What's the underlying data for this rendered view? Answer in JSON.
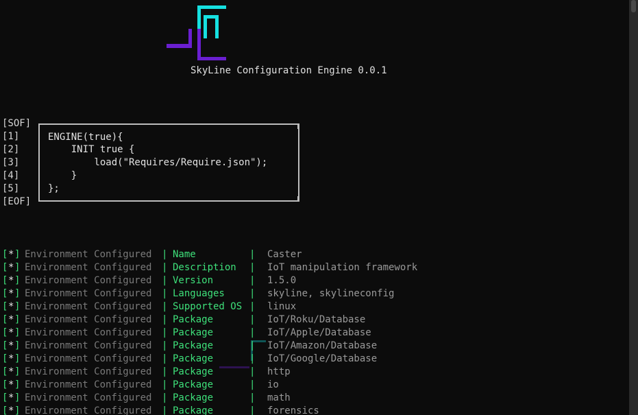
{
  "header": {
    "title": "SkyLine Configuration Engine 0.0.1",
    "colors": {
      "logo_cyan": "#16e0e0",
      "logo_purple": "#6a1fd1",
      "accent_green": "#3ee07a"
    }
  },
  "config_file": {
    "labels": [
      "[SOF]",
      "[1]",
      "[2]",
      "[3]",
      "[4]",
      "[5]",
      "[EOF]"
    ],
    "code_lines": [
      "ENGINE(true){",
      "    INIT true {",
      "        load(\"Requires/Require.json\");",
      "    }",
      "};"
    ]
  },
  "environment": {
    "marker_open": "[",
    "marker_star": "*",
    "marker_close": "]",
    "status_text": "Environment Configured",
    "pipe": "|",
    "rows": [
      {
        "key": "Name",
        "value": "Caster"
      },
      {
        "key": "Description",
        "value": "IoT manipulation framework"
      },
      {
        "key": "Version",
        "value": "1.5.0"
      },
      {
        "key": "Languages",
        "value": "skyline, skylineconfig"
      },
      {
        "key": "Supported OS",
        "value": "linux"
      },
      {
        "key": "Package",
        "value": "IoT/Roku/Database"
      },
      {
        "key": "Package",
        "value": "IoT/Apple/Database"
      },
      {
        "key": "Package",
        "value": "IoT/Amazon/Database"
      },
      {
        "key": "Package",
        "value": "IoT/Google/Database"
      },
      {
        "key": "Package",
        "value": "http"
      },
      {
        "key": "Package",
        "value": "io"
      },
      {
        "key": "Package",
        "value": "math"
      },
      {
        "key": "Package",
        "value": "forensics"
      }
    ]
  }
}
